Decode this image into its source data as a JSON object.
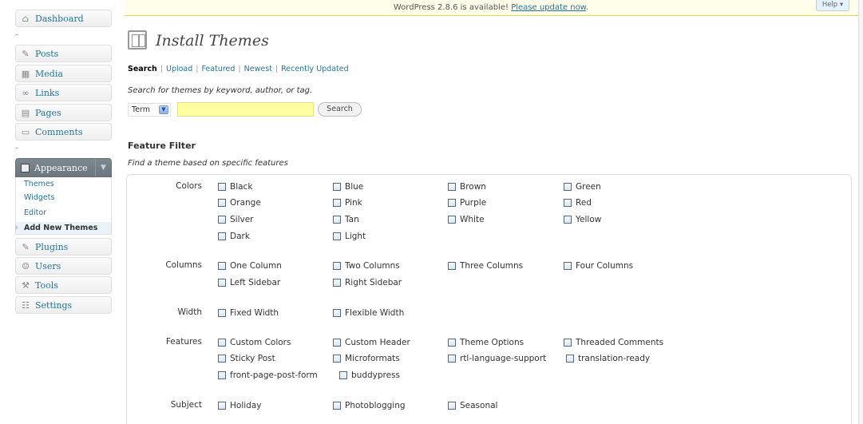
{
  "notice": {
    "text": "WordPress 2.8.6 is available! ",
    "link": "Please update now",
    "suffix": "."
  },
  "help_label": "Help ▾",
  "sidebar": {
    "dashboard": "Dashboard",
    "posts": "Posts",
    "media": "Media",
    "links": "Links",
    "pages": "Pages",
    "comments": "Comments",
    "appearance": "Appearance",
    "appearance_sub": [
      "Themes",
      "Widgets",
      "Editor",
      "Add New Themes"
    ],
    "plugins": "Plugins",
    "users": "Users",
    "tools": "Tools",
    "settings": "Settings"
  },
  "page": {
    "title": "Install Themes",
    "tabs": [
      "Search",
      "Upload",
      "Featured",
      "Newest",
      "Recently Updated"
    ],
    "search_note": "Search for themes by keyword, author, or tag.",
    "term_select": "Term",
    "search_value": "",
    "search_button": "Search",
    "filter_title": "Feature Filter",
    "filter_note": "Find a theme based on specific features"
  },
  "filters": {
    "colors": {
      "label": "Colors",
      "options": [
        "Black",
        "Blue",
        "Brown",
        "Green",
        "Orange",
        "Pink",
        "Purple",
        "Red",
        "Silver",
        "Tan",
        "White",
        "Yellow",
        "Dark",
        "Light"
      ]
    },
    "columns": {
      "label": "Columns",
      "options": [
        "One Column",
        "Two Columns",
        "Three Columns",
        "Four Columns",
        "Left Sidebar",
        "Right Sidebar"
      ]
    },
    "width": {
      "label": "Width",
      "options": [
        "Fixed Width",
        "Flexible Width"
      ]
    },
    "features": {
      "label": "Features",
      "options": [
        "Custom Colors",
        "Custom Header",
        "Theme Options",
        "Threaded Comments",
        "Sticky Post",
        "Microformats",
        "rtl-language-support",
        "translation-ready",
        "front-page-post-form",
        "buddypress"
      ]
    },
    "subject": {
      "label": "Subject",
      "options": [
        "Holiday",
        "Photoblogging",
        "Seasonal"
      ]
    }
  }
}
